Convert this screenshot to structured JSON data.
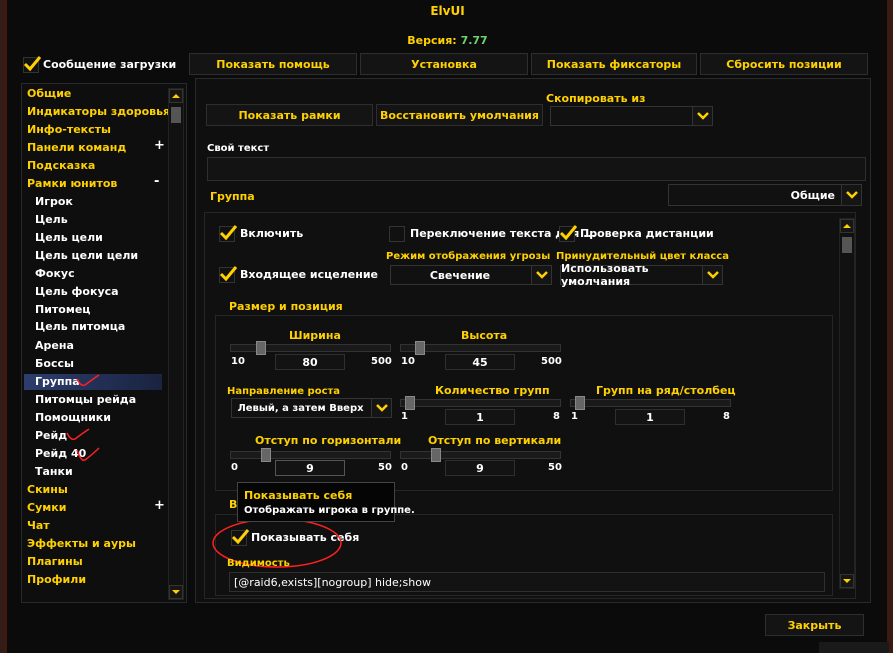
{
  "window": {
    "title": "ElvUI",
    "version_label": "Версия:",
    "version_value": "7.77"
  },
  "top": {
    "login_message_label": "Сообщение загрузки",
    "login_message_checked": true,
    "buttons": [
      "Показать помощь",
      "Установка",
      "Показать фиксаторы",
      "Сбросить позиции"
    ]
  },
  "sidebar": {
    "items": [
      {
        "label": "Общие",
        "type": "top"
      },
      {
        "label": "Индикаторы здоровья",
        "type": "top"
      },
      {
        "label": "Инфо-тексты",
        "type": "top"
      },
      {
        "label": "Панели команд",
        "type": "top",
        "expand": "+"
      },
      {
        "label": "Подсказка",
        "type": "top"
      },
      {
        "label": "Рамки юнитов",
        "type": "top",
        "expand": "-"
      },
      {
        "label": "Игрок",
        "type": "sub"
      },
      {
        "label": "Цель",
        "type": "sub"
      },
      {
        "label": "Цель цели",
        "type": "sub"
      },
      {
        "label": "Цель цели цели",
        "type": "sub"
      },
      {
        "label": "Фокус",
        "type": "sub"
      },
      {
        "label": "Цель фокуса",
        "type": "sub"
      },
      {
        "label": "Питомец",
        "type": "sub"
      },
      {
        "label": "Цель питомца",
        "type": "sub"
      },
      {
        "label": "Арена",
        "type": "sub"
      },
      {
        "label": "Боссы",
        "type": "sub"
      },
      {
        "label": "Группа",
        "type": "sub",
        "selected": true
      },
      {
        "label": "Питомцы рейда",
        "type": "sub"
      },
      {
        "label": "Помощники",
        "type": "sub"
      },
      {
        "label": "Рейд",
        "type": "sub"
      },
      {
        "label": "Рейд 40",
        "type": "sub"
      },
      {
        "label": "Танки",
        "type": "sub"
      },
      {
        "label": "Скины",
        "type": "top"
      },
      {
        "label": "Сумки",
        "type": "top",
        "expand": "+"
      },
      {
        "label": "Чат",
        "type": "top"
      },
      {
        "label": "Эффекты и ауры",
        "type": "top"
      },
      {
        "label": "Плагины",
        "type": "top"
      },
      {
        "label": "Профили",
        "type": "top"
      }
    ]
  },
  "panel": {
    "show_frames_button": "Показать рамки",
    "restore_defaults_button": "Восстановить умолчания",
    "copy_from_label": "Скопировать из",
    "copy_from_value": "",
    "custom_text_label": "Свой текст",
    "group_label": "Группа",
    "group_dropdown_value": "Общие",
    "enable_label": "Включить",
    "enable_checked": true,
    "text_toggle_label": "Переключение текста для ...",
    "text_toggle_checked": false,
    "range_check_label": "Проверка дистанции",
    "range_check_checked": true,
    "incoming_heal_label": "Входящее исцеление",
    "incoming_heal_checked": true,
    "threat_mode_label": "Режим отображения угрозы",
    "threat_mode_value": "Свечение",
    "force_class_color_label": "Принудительный цвет класса",
    "force_class_color_value": "Использовать умолчания",
    "size_position_label": "Размер и позиция",
    "width": {
      "label": "Ширина",
      "min": "10",
      "max": "500",
      "value": "80",
      "fraction": 0.14
    },
    "height": {
      "label": "Высота",
      "min": "10",
      "max": "500",
      "value": "45",
      "fraction": 0.07
    },
    "growth_direction_label": "Направление роста",
    "growth_direction_value": "Левый, а затем Вверх",
    "num_groups": {
      "label": "Количество групп",
      "min": "1",
      "max": "8",
      "value": "1",
      "fraction": 0.0
    },
    "groups_per_row": {
      "label": "Групп на ряд/столбец",
      "min": "1",
      "max": "8",
      "value": "1",
      "fraction": 0.0
    },
    "h_spacing": {
      "label": "Отступ по горизонтали",
      "min": "0",
      "max": "50",
      "value": "9",
      "fraction": 0.18
    },
    "v_spacing": {
      "label": "Отступ по вертикали",
      "min": "0",
      "max": "50",
      "value": "9",
      "fraction": 0.18
    },
    "visibility_section_label": "В",
    "show_player_label": "Показывать себя",
    "show_player_checked": true,
    "visibility_label": "Видимость",
    "visibility_value": "[@raid6,exists][nogroup] hide;show"
  },
  "tooltip": {
    "title": "Показывать себя",
    "text": "Отображать игрока в группе."
  },
  "footer": {
    "close_button": "Закрыть"
  },
  "colors": {
    "accent_gold": "#ffd100",
    "version_green": "#6cd36c",
    "annotation_red": "#ff2020"
  }
}
